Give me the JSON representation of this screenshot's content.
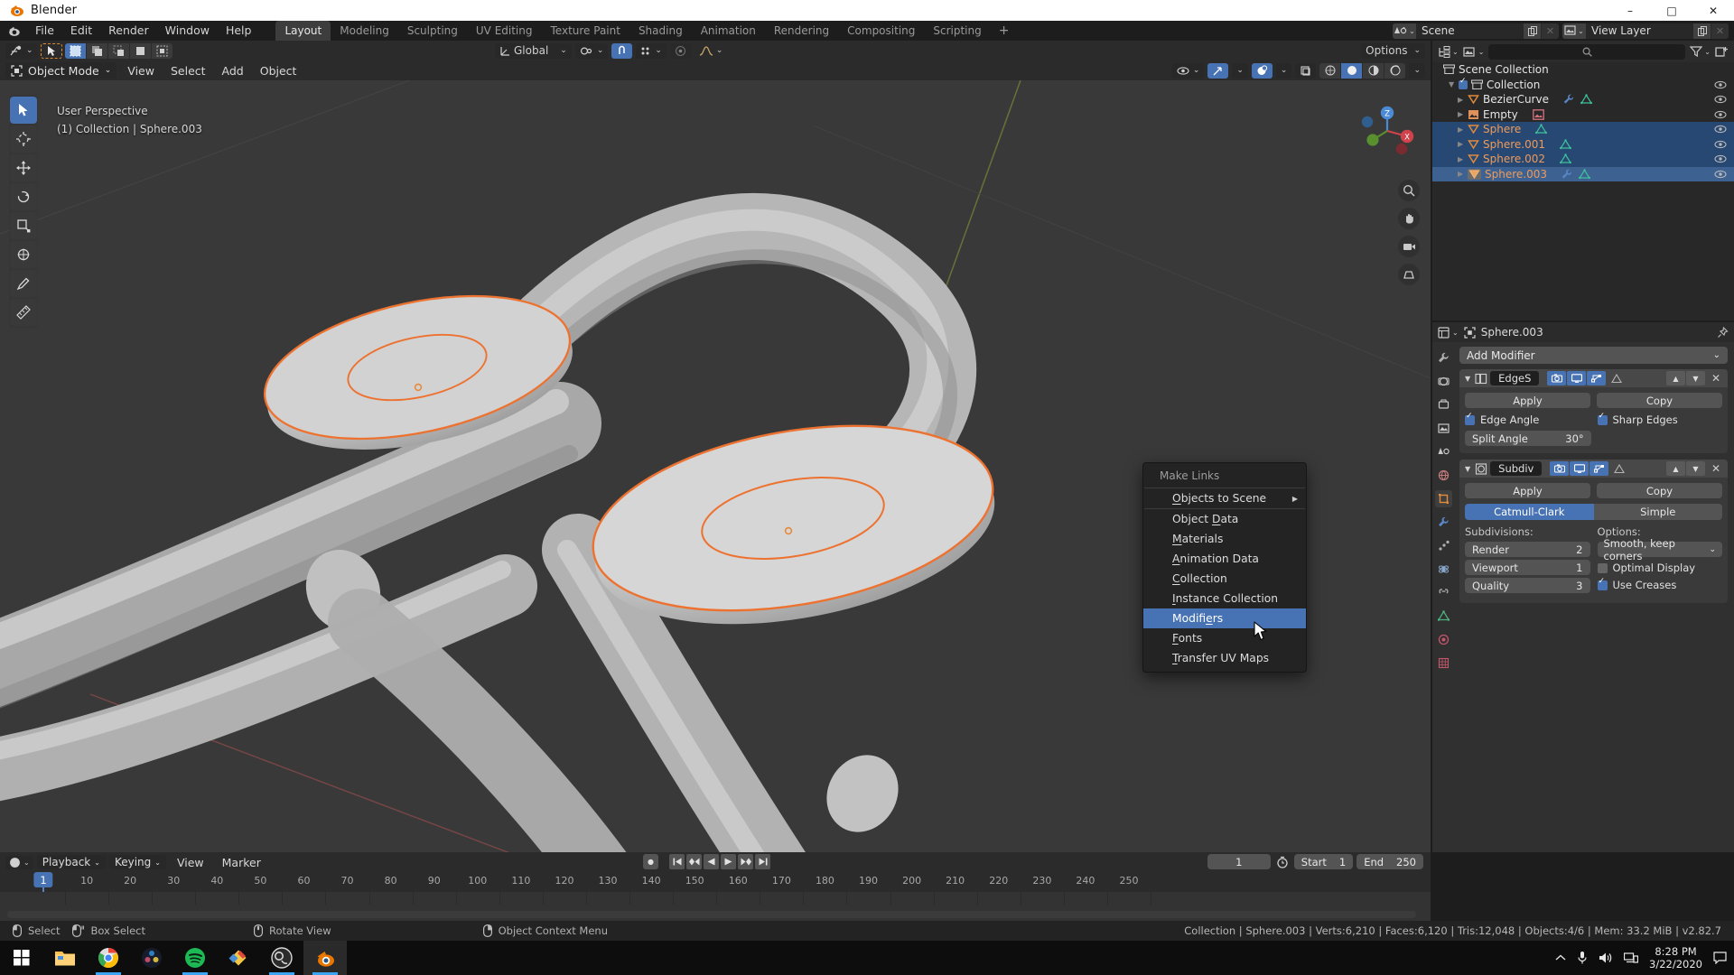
{
  "window": {
    "title": "Blender",
    "min": "–",
    "max": "□",
    "close": "✕"
  },
  "topbar": {
    "menus": [
      "File",
      "Edit",
      "Render",
      "Window",
      "Help"
    ],
    "workspaces": [
      "Layout",
      "Modeling",
      "Sculpting",
      "UV Editing",
      "Texture Paint",
      "Shading",
      "Animation",
      "Rendering",
      "Compositing",
      "Scripting"
    ],
    "active_workspace": "Layout",
    "add_workspace": "+",
    "scene_name": "Scene",
    "view_layer_name": "View Layer"
  },
  "viewport_header": {
    "transform_orientation": "Global",
    "options_label": "Options"
  },
  "viewport_header2": {
    "mode": "Object Mode",
    "menus": [
      "View",
      "Select",
      "Add",
      "Object"
    ]
  },
  "viewport": {
    "perspective_label": "User Perspective",
    "object_label": "(1) Collection | Sphere.003",
    "gizmo_axes": [
      "X",
      "Y",
      "Z"
    ]
  },
  "outliner": {
    "search_placeholder": "",
    "root": "Scene Collection",
    "items": [
      {
        "label": "Collection",
        "indent": 1,
        "selected": false,
        "strong": false,
        "icon": "collection-icon",
        "checkbox": true,
        "badges": []
      },
      {
        "label": "BezierCurve",
        "indent": 2,
        "selected": false,
        "strong": false,
        "icon": "curve-icon",
        "checkbox": false,
        "badges": [
          "wrench-icon",
          "mesh-data-icon"
        ]
      },
      {
        "label": "Empty",
        "indent": 2,
        "selected": false,
        "strong": false,
        "icon": "empty-image-icon",
        "checkbox": false,
        "badges": [
          "image-icon"
        ]
      },
      {
        "label": "Sphere",
        "indent": 2,
        "selected": true,
        "strong": false,
        "icon": "mesh-icon",
        "checkbox": false,
        "badges": [
          "mesh-data-icon"
        ]
      },
      {
        "label": "Sphere.001",
        "indent": 2,
        "selected": true,
        "strong": false,
        "icon": "mesh-icon",
        "checkbox": false,
        "badges": [
          "mesh-data-icon"
        ]
      },
      {
        "label": "Sphere.002",
        "indent": 2,
        "selected": true,
        "strong": false,
        "icon": "mesh-icon",
        "checkbox": false,
        "badges": [
          "mesh-data-icon"
        ]
      },
      {
        "label": "Sphere.003",
        "indent": 2,
        "selected": true,
        "strong": true,
        "icon": "mesh-icon",
        "checkbox": false,
        "badges": [
          "wrench-icon",
          "mesh-data-icon"
        ]
      }
    ]
  },
  "properties": {
    "breadcrumb_object": "Sphere.003",
    "add_modifier": "Add Modifier",
    "modifiers": [
      {
        "name": "EdgeS",
        "icon": "edge-split-icon",
        "apply": "Apply",
        "copy": "Copy",
        "checkboxes": [
          {
            "label": "Edge Angle",
            "checked": true
          },
          {
            "label": "Sharp Edges",
            "checked": true
          }
        ],
        "split_angle_label": "Split Angle",
        "split_angle_value": "30°"
      },
      {
        "name": "Subdiv",
        "icon": "subdivision-icon",
        "apply": "Apply",
        "copy": "Copy",
        "algorithm_options": [
          "Catmull-Clark",
          "Simple"
        ],
        "algorithm_active": "Catmull-Clark",
        "subdivisions_label": "Subdivisions:",
        "options_label": "Options:",
        "fields": [
          {
            "label": "Render",
            "value": "2"
          },
          {
            "label": "Viewport",
            "value": "1"
          },
          {
            "label": "Quality",
            "value": "3"
          }
        ],
        "uv_smooth": "Smooth, keep corners",
        "checkboxes": [
          {
            "label": "Optimal Display",
            "checked": false
          },
          {
            "label": "Use Creases",
            "checked": true
          }
        ]
      }
    ]
  },
  "context_menu": {
    "title": "Make Links",
    "items": [
      {
        "label": "Objects to Scene",
        "underline": 0,
        "submenu": true,
        "highlighted": false,
        "separator_after": true
      },
      {
        "label": "Object Data",
        "underline": 7,
        "submenu": false,
        "highlighted": false
      },
      {
        "label": "Materials",
        "underline": 0,
        "submenu": false,
        "highlighted": false
      },
      {
        "label": "Animation Data",
        "underline": 0,
        "submenu": false,
        "highlighted": false
      },
      {
        "label": "Collection",
        "underline": 0,
        "submenu": false,
        "highlighted": false
      },
      {
        "label": "Instance Collection",
        "underline": 0,
        "submenu": false,
        "highlighted": false
      },
      {
        "label": "Modifiers",
        "underline": 6,
        "submenu": false,
        "highlighted": true
      },
      {
        "label": "Fonts",
        "underline": 0,
        "submenu": false,
        "highlighted": false
      },
      {
        "label": "Transfer UV Maps",
        "underline": 0,
        "submenu": false,
        "highlighted": false
      }
    ]
  },
  "timeline": {
    "editor_menus": [
      "Playback",
      "Keying",
      "View",
      "Marker"
    ],
    "current_frame": "1",
    "start_label": "Start",
    "start_value": "1",
    "end_label": "End",
    "end_value": "250",
    "ruler_ticks": [
      "1",
      "10",
      "20",
      "30",
      "40",
      "50",
      "60",
      "70",
      "80",
      "90",
      "100",
      "110",
      "120",
      "130",
      "140",
      "150",
      "160",
      "170",
      "180",
      "190",
      "200",
      "210",
      "220",
      "230",
      "240",
      "250"
    ]
  },
  "statusbar": {
    "hints": [
      {
        "icon": "mouse-left-icon",
        "label": "Select"
      },
      {
        "icon": "mouse-left-drag-icon",
        "label": "Box Select"
      },
      {
        "icon": "mouse-middle-icon",
        "label": "Rotate View"
      },
      {
        "icon": "mouse-right-icon",
        "label": "Object Context Menu"
      }
    ],
    "scene_stats": "Collection | Sphere.003 | Verts:6,210 | Faces:6,120 | Tris:12,048 | Objects:4/6 | Mem: 33.2 MiB | v2.82.7"
  },
  "taskbar": {
    "apps": [
      "start-icon",
      "file-explorer-icon",
      "chrome-icon",
      "davinci-resolve-icon",
      "spotify-icon",
      "paint-3d-icon",
      "obs-icon",
      "blender-icon"
    ],
    "tray_icons": [
      "chevron-up-icon",
      "microphone-icon",
      "volume-icon",
      "network-icon",
      "notification-icon"
    ],
    "time": "8:28 PM",
    "date": "3/22/2020"
  },
  "colors": {
    "accent_blue": "#4772b3",
    "selection_orange": "#ed7230",
    "panel_bg": "#303030",
    "viewport_bg": "#393939"
  }
}
